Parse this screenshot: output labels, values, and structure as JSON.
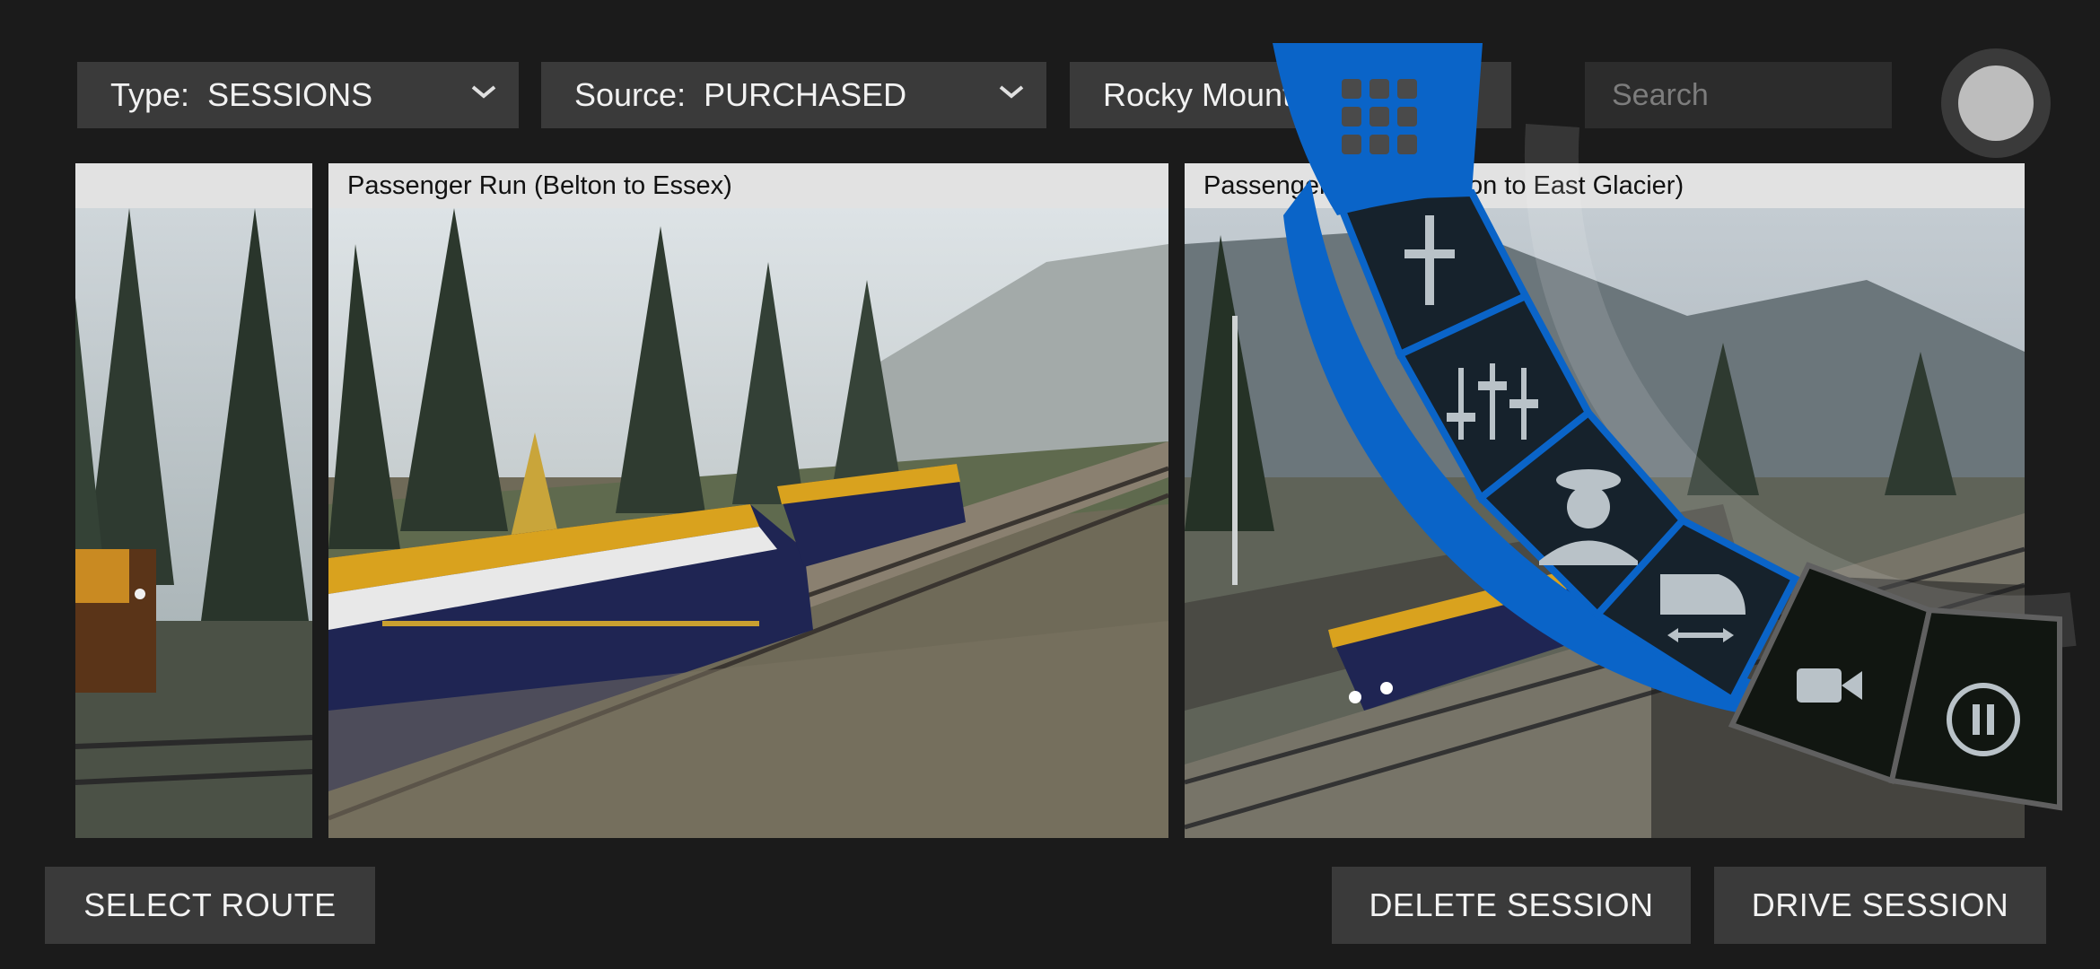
{
  "filters": {
    "type": {
      "label": "Type:",
      "value": "SESSIONS"
    },
    "source": {
      "label": "Source:",
      "value": "PURCHASED"
    },
    "route": {
      "value": "Rocky Mountai"
    },
    "search_placeholder": "Search"
  },
  "cards": [
    {
      "title": ""
    },
    {
      "title": "Passenger Run (Belton to Essex)"
    },
    {
      "title": "Passenger Run (Harrison to East Glacier)"
    }
  ],
  "buttons": {
    "select_route": "SELECT ROUTE",
    "delete_session": "DELETE SESSION",
    "drive_session": "DRIVE SESSION"
  },
  "radial_menu": {
    "items": [
      "grid-icon",
      "signal-icon",
      "sliders-icon",
      "driver-icon",
      "train-switch-icon",
      "camera-icon",
      "pause-icon"
    ],
    "accent": "#0a64c8"
  },
  "colors": {
    "background": "#1b1b1b",
    "panel": "#3a3a3a"
  }
}
